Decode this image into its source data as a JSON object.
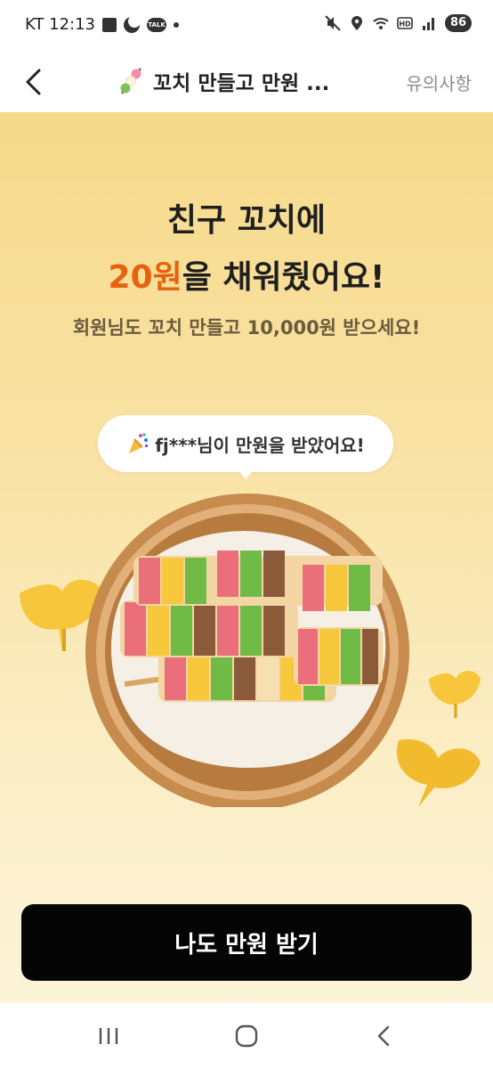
{
  "status_bar": {
    "carrier_time": "KT 12:13",
    "talk_badge": "TALK",
    "battery": "86"
  },
  "header": {
    "title": "꼬치 만들고 만원 ...",
    "notice": "유의사항"
  },
  "hero": {
    "headline_line1": "친구 꼬치에",
    "amount": "20원",
    "headline_line2_rest": "을 채워줬어요!",
    "subtitle": "회원님도 꼬치 만들고 10,000원 받으세요!",
    "bubble_text": "fj***님이 만원을 받았어요!"
  },
  "cta": {
    "label": "나도 만원 받기"
  },
  "colors": {
    "accent": "#e5620f",
    "cta_bg": "#050505",
    "hero_top": "#f6d98a",
    "hero_bottom": "#fcf3d8"
  },
  "icons": [
    "back-arrow-icon",
    "dango-skewer-icon",
    "party-popper-icon",
    "recent-apps-icon",
    "home-icon",
    "nav-back-icon"
  ]
}
